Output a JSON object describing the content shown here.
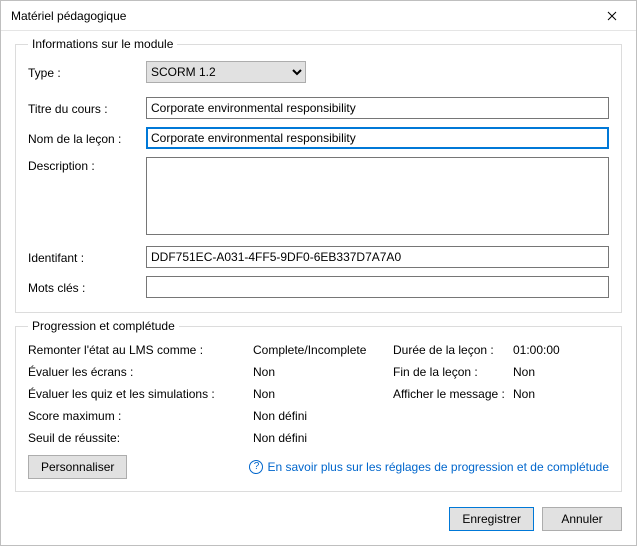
{
  "title": "Matériel pédagogique",
  "module_info": {
    "legend": "Informations sur le module",
    "type_label": "Type :",
    "type_value": "SCORM 1.2",
    "course_title_label": "Titre du cours :",
    "course_title_value": "Corporate environmental responsibility",
    "lesson_name_label": "Nom de la leçon :",
    "lesson_name_value": "Corporate environmental responsibility",
    "description_label": "Description :",
    "description_value": "",
    "identifier_label": "Identifant :",
    "identifier_value": "DDF751EC-A031-4FF5-9DF0-6EB337D7A7A0",
    "keywords_label": "Mots clés :",
    "keywords_value": ""
  },
  "progress": {
    "legend": "Progression et complétude",
    "report_label": "Remonter l'état au LMS comme :",
    "report_value": "Complete/Incomplete",
    "duration_label": "Durée de la leçon :",
    "duration_value": "01:00:00",
    "eval_screens_label": "Évaluer les écrans :",
    "eval_screens_value": "Non",
    "end_label": "Fin de la leçon :",
    "end_value": "Non",
    "eval_quiz_label": "Évaluer les quiz et les simulations :",
    "eval_quiz_value": "Non",
    "show_msg_label": "Afficher le message :",
    "show_msg_value": "Non",
    "max_score_label": "Score maximum :",
    "max_score_value": "Non défini",
    "pass_threshold_label": "Seuil de réussite:",
    "pass_threshold_value": "Non défini",
    "customize_button": "Personnaliser",
    "link_text": "En savoir plus sur les réglages de progression et de complétude"
  },
  "footer": {
    "save": "Enregistrer",
    "cancel": "Annuler"
  }
}
